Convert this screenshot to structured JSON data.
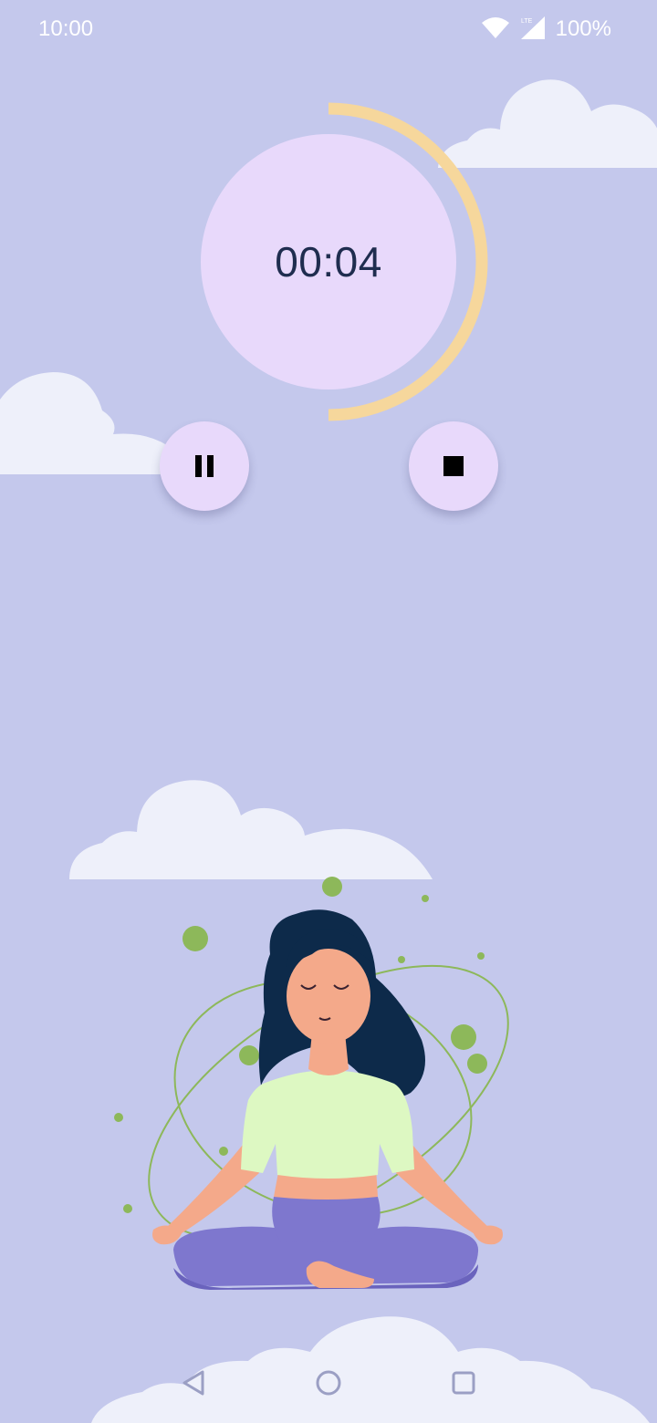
{
  "status_bar": {
    "time": "10:00",
    "network": "LTE",
    "battery": "100%"
  },
  "timer": {
    "display": "00:04",
    "progress": 0.5,
    "track_color": "#f6d79c",
    "face_color": "#e8d9fb"
  },
  "controls": {
    "pause_icon": "pause-icon",
    "stop_icon": "stop-icon"
  },
  "illustration": {
    "subject": "meditating-woman"
  },
  "navigation": {
    "back_icon": "back-triangle-icon",
    "home_icon": "home-circle-icon",
    "recents_icon": "recents-square-icon"
  },
  "colors": {
    "background": "#c4c8ec",
    "cloud": "#eef0fa",
    "accent_green": "#8db85a"
  }
}
